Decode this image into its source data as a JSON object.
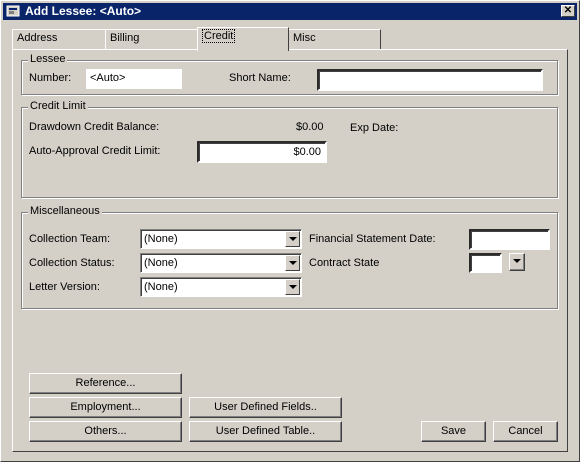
{
  "window": {
    "title": "Add Lessee: <Auto>"
  },
  "tabs": [
    {
      "label": "Address"
    },
    {
      "label": "Billing"
    },
    {
      "label": "Credit"
    },
    {
      "label": "Misc"
    }
  ],
  "lessee": {
    "group_title": "Lessee",
    "number_label": "Number:",
    "number_value": "<Auto>",
    "short_name_label": "Short Name:",
    "short_name_value": ""
  },
  "credit_limit": {
    "group_title": "Credit Limit",
    "drawdown_label": "Drawdown Credit Balance:",
    "drawdown_value": "$0.00",
    "exp_date_label": "Exp Date:",
    "auto_approval_label": "Auto-Approval Credit Limit:",
    "auto_approval_value": "$0.00"
  },
  "misc": {
    "group_title": "Miscellaneous",
    "collection_team_label": "Collection Team:",
    "collection_team_value": "(None)",
    "collection_status_label": "Collection Status:",
    "collection_status_value": "(None)",
    "letter_version_label": "Letter Version:",
    "letter_version_value": "(None)",
    "financial_statement_label": "Financial Statement Date:",
    "financial_statement_value": "",
    "contract_state_label": "Contract State",
    "contract_state_value": ""
  },
  "buttons": {
    "reference": "Reference...",
    "employment": "Employment...",
    "others": "Others...",
    "user_defined_fields": "User Defined Fields..",
    "user_defined_table": "User Defined Table..",
    "save": "Save",
    "cancel": "Cancel"
  }
}
